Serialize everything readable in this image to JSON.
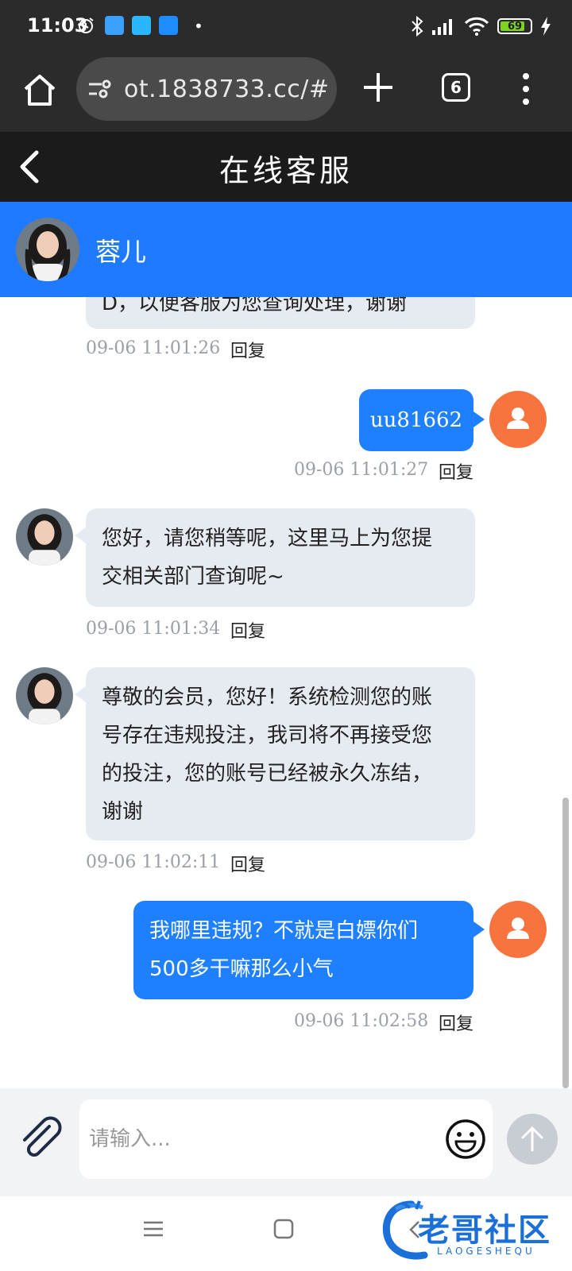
{
  "status_bar": {
    "time": "11:03",
    "battery": "69",
    "battery_level": 0.69
  },
  "browser": {
    "url": "ot.1838733.cc/#",
    "tab_count": "6"
  },
  "header": {
    "title": "在线客服"
  },
  "agent": {
    "name": "蓉儿"
  },
  "messages": [
    {
      "direction": "in",
      "text": "D，以便客服为您查询处理，谢谢",
      "time": "09-06 11:01:26",
      "reply": "回复"
    },
    {
      "direction": "out",
      "text": "uu81662",
      "time": "09-06 11:01:27",
      "reply": "回复"
    },
    {
      "direction": "in",
      "lines": [
        "您好，请您稍等呢，这里马上为您提",
        "交相关部门查询呢~"
      ],
      "time": "09-06 11:01:34",
      "reply": "回复"
    },
    {
      "direction": "in",
      "lines": [
        "尊敬的会员，您好！系统检测您的账",
        "号存在违规投注，我司将不再接受您",
        "的投注，您的账号已经被永久冻结，",
        "谢谢"
      ],
      "time": "09-06 11:02:11",
      "reply": "回复"
    },
    {
      "direction": "out",
      "lines": [
        "我哪里违规？不就是白嫖你们",
        "500多干嘛那么小气"
      ],
      "time": "09-06 11:02:58",
      "reply": "回复"
    }
  ],
  "input": {
    "placeholder": "请输入..."
  },
  "watermark": {
    "text": "老哥社区",
    "subtext": "LAOGESHEQU"
  },
  "colors": {
    "accent": "#1e7bff",
    "bubble_in": "#e6ebf2",
    "bubble_out": "#1e80ff",
    "user_avatar": "#f7743f",
    "header_bg": "#1b1b1b"
  },
  "icons": [
    "alarm-icon",
    "gallery-icon",
    "cloud-icon",
    "nfc-icon",
    "bluetooth-icon",
    "signal-icon",
    "wifi-icon",
    "battery-icon",
    "home-icon",
    "site-settings-icon",
    "plus-icon",
    "tabs-icon",
    "more-icon",
    "back-icon",
    "paperclip-icon",
    "emoji-icon",
    "send-icon",
    "nav-menu-icon",
    "nav-home-icon",
    "nav-back-icon"
  ]
}
